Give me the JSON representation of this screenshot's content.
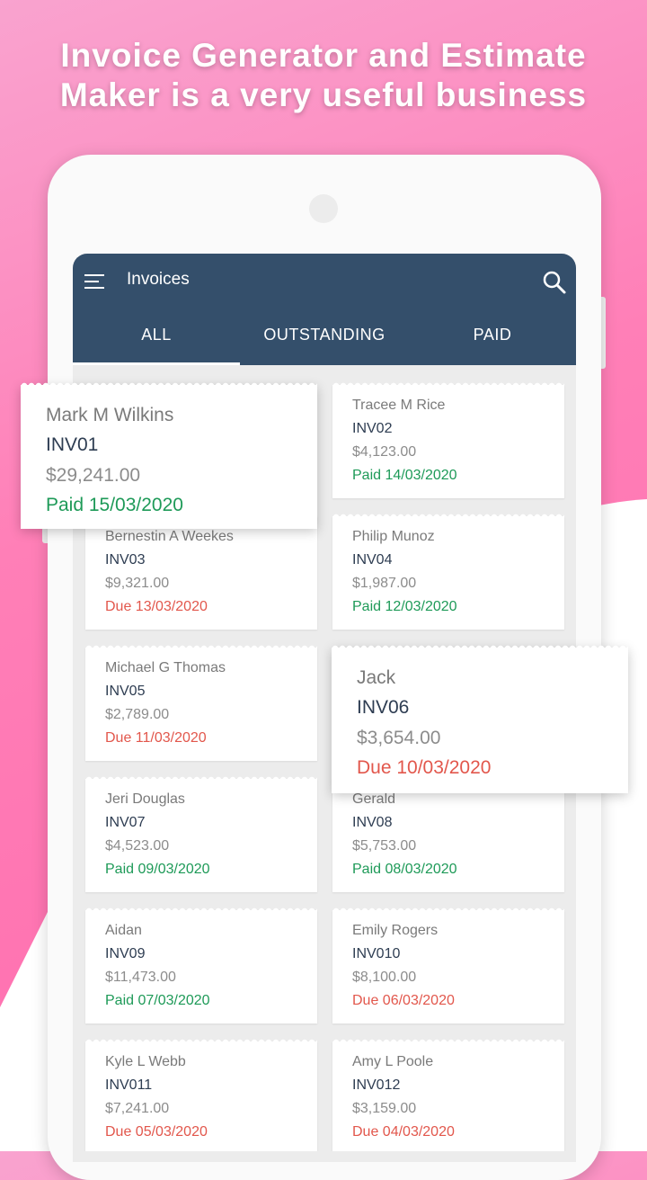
{
  "headline": {
    "line1": "Invoice Generator and Estimate",
    "line2": "Maker is a very useful business"
  },
  "appbar": {
    "title": "Invoices",
    "menu_icon": "hamburger-menu-icon",
    "search_icon": "search-icon"
  },
  "tabs": [
    {
      "label": "ALL",
      "selected": true
    },
    {
      "label": "OUTSTANDING",
      "selected": false
    },
    {
      "label": "PAID",
      "selected": false
    }
  ],
  "invoices": [
    {
      "name": "Mark M Wilkins",
      "number": "INV01",
      "amount": "$29,241.00",
      "status": "Paid 15/03/2020",
      "state": "paid"
    },
    {
      "name": "Tracee M Rice",
      "number": "INV02",
      "amount": "$4,123.00",
      "status": "Paid 14/03/2020",
      "state": "paid"
    },
    {
      "name": "Bernestin A Weekes",
      "number": "INV03",
      "amount": "$9,321.00",
      "status": "Due 13/03/2020",
      "state": "due"
    },
    {
      "name": "Philip Munoz",
      "number": "INV04",
      "amount": "$1,987.00",
      "status": "Paid 12/03/2020",
      "state": "paid"
    },
    {
      "name": "Michael G Thomas",
      "number": "INV05",
      "amount": "$2,789.00",
      "status": "Due 11/03/2020",
      "state": "due"
    },
    {
      "name": "Jack",
      "number": "INV06",
      "amount": "$3,654.00",
      "status": "Due 10/03/2020",
      "state": "due"
    },
    {
      "name": "Jeri Douglas",
      "number": "INV07",
      "amount": "$4,523.00",
      "status": "Paid 09/03/2020",
      "state": "paid"
    },
    {
      "name": "Gerald",
      "number": "INV08",
      "amount": "$5,753.00",
      "status": "Paid 08/03/2020",
      "state": "paid"
    },
    {
      "name": "Aidan",
      "number": "INV09",
      "amount": "$11,473.00",
      "status": "Paid 07/03/2020",
      "state": "paid"
    },
    {
      "name": "Emily Rogers",
      "number": "INV010",
      "amount": "$8,100.00",
      "status": "Due 06/03/2020",
      "state": "due"
    },
    {
      "name": "Kyle L Webb",
      "number": "INV011",
      "amount": "$7,241.00",
      "status": "Due 05/03/2020",
      "state": "due"
    },
    {
      "name": "Amy L Poole",
      "number": "INV012",
      "amount": "$3,159.00",
      "status": "Due 04/03/2020",
      "state": "due"
    }
  ],
  "fab": {
    "icon": "plus-icon"
  },
  "colors": {
    "appbar": "#344f6b",
    "paid": "#1e9a58",
    "due": "#e2574c",
    "fab": "#ef6461",
    "background_pink": "#ff7fb7"
  }
}
